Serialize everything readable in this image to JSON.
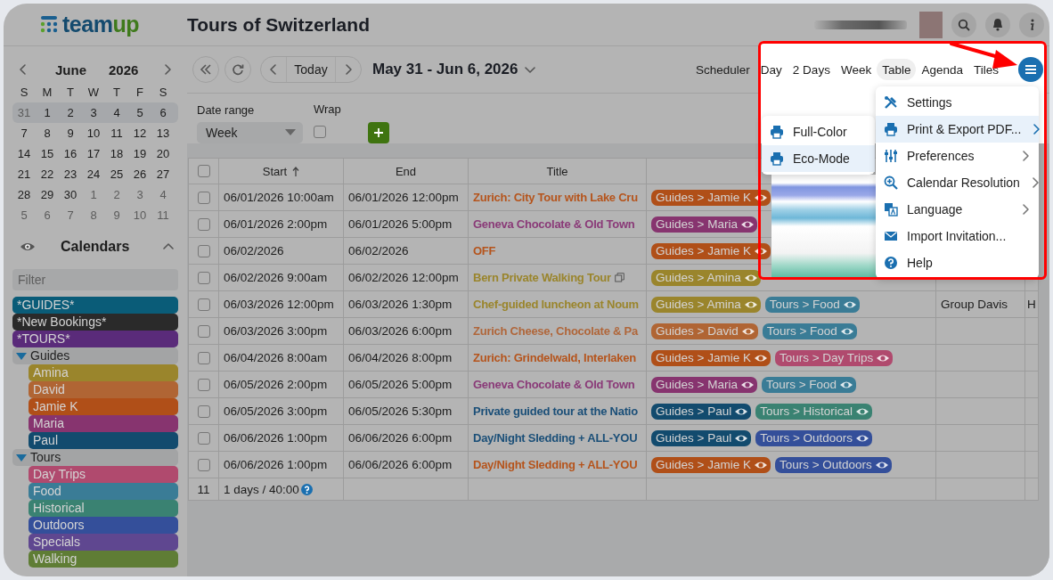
{
  "header": {
    "logo_parts": [
      "team",
      "up"
    ],
    "title": "Tours of Switzerland"
  },
  "mini_calendar": {
    "month": "June",
    "year": "2026",
    "weekdays": [
      "S",
      "M",
      "T",
      "W",
      "T",
      "F",
      "S"
    ],
    "weeks": [
      {
        "selected": true,
        "days": [
          {
            "d": "31",
            "muted": true
          },
          {
            "d": "1",
            "muted": false
          },
          {
            "d": "2",
            "muted": false
          },
          {
            "d": "3",
            "muted": false
          },
          {
            "d": "4",
            "muted": false
          },
          {
            "d": "5",
            "muted": false
          },
          {
            "d": "6",
            "muted": false
          }
        ]
      },
      {
        "selected": false,
        "days": [
          {
            "d": "7",
            "muted": false
          },
          {
            "d": "8",
            "muted": false
          },
          {
            "d": "9",
            "muted": false
          },
          {
            "d": "10",
            "muted": false
          },
          {
            "d": "11",
            "muted": false
          },
          {
            "d": "12",
            "muted": false
          },
          {
            "d": "13",
            "muted": false
          }
        ]
      },
      {
        "selected": false,
        "days": [
          {
            "d": "14",
            "muted": false
          },
          {
            "d": "15",
            "muted": false
          },
          {
            "d": "16",
            "muted": false
          },
          {
            "d": "17",
            "muted": false
          },
          {
            "d": "18",
            "muted": false
          },
          {
            "d": "19",
            "muted": false
          },
          {
            "d": "20",
            "muted": false
          }
        ]
      },
      {
        "selected": false,
        "days": [
          {
            "d": "21",
            "muted": false
          },
          {
            "d": "22",
            "muted": false
          },
          {
            "d": "23",
            "muted": false
          },
          {
            "d": "24",
            "muted": false
          },
          {
            "d": "25",
            "muted": false
          },
          {
            "d": "26",
            "muted": false
          },
          {
            "d": "27",
            "muted": false
          }
        ]
      },
      {
        "selected": false,
        "days": [
          {
            "d": "28",
            "muted": false
          },
          {
            "d": "29",
            "muted": false
          },
          {
            "d": "30",
            "muted": false
          },
          {
            "d": "1",
            "muted": true
          },
          {
            "d": "2",
            "muted": true
          },
          {
            "d": "3",
            "muted": true
          },
          {
            "d": "4",
            "muted": true
          }
        ]
      },
      {
        "selected": false,
        "days": [
          {
            "d": "5",
            "muted": true
          },
          {
            "d": "6",
            "muted": true
          },
          {
            "d": "7",
            "muted": true
          },
          {
            "d": "8",
            "muted": true
          },
          {
            "d": "9",
            "muted": true
          },
          {
            "d": "10",
            "muted": true
          },
          {
            "d": "11",
            "muted": true
          }
        ]
      }
    ]
  },
  "calendars": {
    "title": "Calendars",
    "expanded": true,
    "filter_placeholder": "Filter",
    "items": [
      {
        "kind": "calendar",
        "label": "*GUIDES*",
        "color": "#0a5c78"
      },
      {
        "kind": "calendar",
        "label": "*New Bookings*",
        "color": "#2a2a2a"
      },
      {
        "kind": "calendar",
        "label": "*TOURS*",
        "color": "#5a2b7a"
      },
      {
        "kind": "folder",
        "label": "Guides",
        "expanded": true,
        "children": [
          {
            "kind": "calendar",
            "label": "Amina",
            "color": "#9a852c"
          },
          {
            "kind": "calendar",
            "label": "David",
            "color": "#b06534"
          },
          {
            "kind": "calendar",
            "label": "Jamie K",
            "color": "#b04f18"
          },
          {
            "kind": "calendar",
            "label": "Maria",
            "color": "#87346f"
          },
          {
            "kind": "calendar",
            "label": "Paul",
            "color": "#124b6e"
          }
        ]
      },
      {
        "kind": "folder",
        "label": "Tours",
        "expanded": true,
        "children": [
          {
            "kind": "calendar",
            "label": "Day Trips",
            "color": "#b04a6e"
          },
          {
            "kind": "calendar",
            "label": "Food",
            "color": "#3a7c96"
          },
          {
            "kind": "calendar",
            "label": "Historical",
            "color": "#3a8272"
          },
          {
            "kind": "calendar",
            "label": "Outdoors",
            "color": "#344f9a"
          },
          {
            "kind": "calendar",
            "label": "Specials",
            "color": "#5f4790"
          },
          {
            "kind": "calendar",
            "label": "Walking",
            "color": "#5f7d35"
          }
        ]
      }
    ]
  },
  "toolbar": {
    "today": "Today",
    "range": "May 31 - Jun 6, 2026",
    "views": [
      {
        "label": "Scheduler",
        "selected": false
      },
      {
        "label": "Day",
        "selected": false
      },
      {
        "label": "2 Days",
        "selected": false
      },
      {
        "label": "Week",
        "selected": false
      },
      {
        "label": "Table",
        "selected": true
      },
      {
        "label": "Agenda",
        "selected": false
      },
      {
        "label": "Tiles",
        "selected": false
      }
    ]
  },
  "filters": {
    "date_range_label": "Date range",
    "date_range_value": "Week",
    "wrap_label": "Wrap",
    "wrap_checked": false
  },
  "table": {
    "all_checked": false,
    "columns": [
      {
        "label": "Start",
        "sorted": true
      },
      {
        "label": "End",
        "sorted": false
      },
      {
        "label": "Title",
        "sorted": false
      }
    ],
    "rows": [
      {
        "checked": false,
        "start": "06/01/2026 10:00am",
        "end": "06/01/2026 12:00pm",
        "title": "Zurich: City Tour with Lake Cru",
        "color": "#b5541c",
        "copy_icon": false,
        "tags": [
          {
            "label": "Guides > Jamie K",
            "color": "#b04f18"
          }
        ]
      },
      {
        "checked": false,
        "start": "06/01/2026 2:00pm",
        "end": "06/01/2026 5:00pm",
        "title": "Geneva Chocolate & Old Town",
        "color": "#8a3a78",
        "copy_icon": false,
        "tags": [
          {
            "label": "Guides > Maria",
            "color": "#87346f"
          }
        ]
      },
      {
        "checked": false,
        "start": "06/02/2026",
        "end": "06/02/2026",
        "title": "OFF",
        "color": "#b5541c",
        "copy_icon": false,
        "tags": [
          {
            "label": "Guides > Jamie K",
            "color": "#b04f18"
          }
        ]
      },
      {
        "checked": false,
        "start": "06/02/2026 9:00am",
        "end": "06/02/2026 12:00pm",
        "title": "Bern Private Walking Tour",
        "color": "#9a852c",
        "copy_icon": true,
        "tags": [
          {
            "label": "Guides > Amina",
            "color": "#9a852c"
          }
        ]
      },
      {
        "checked": false,
        "start": "06/03/2026 12:00pm",
        "end": "06/03/2026 1:30pm",
        "title": "Chef-guided luncheon at Noum",
        "color": "#9a852c",
        "copy_icon": false,
        "tags": [
          {
            "label": "Guides > Amina",
            "color": "#9a852c"
          },
          {
            "label": "Tours > Food",
            "color": "#3a7c96"
          }
        ],
        "column_6": "Group Davis",
        "column_7": "H"
      },
      {
        "checked": false,
        "start": "06/03/2026 3:00pm",
        "end": "06/03/2026 6:00pm",
        "title": "Zurich Cheese, Chocolate & Pa",
        "color": "#b0663a",
        "copy_icon": false,
        "tags": [
          {
            "label": "Guides > David",
            "color": "#b06534"
          },
          {
            "label": "Tours > Food",
            "color": "#3a7c96"
          }
        ]
      },
      {
        "checked": false,
        "start": "06/04/2026 8:00am",
        "end": "06/04/2026 8:00pm",
        "title": "Zurich: Grindelwald, Interlaken",
        "color": "#b5541c",
        "copy_icon": false,
        "tags": [
          {
            "label": "Guides > Jamie K",
            "color": "#b04f18"
          },
          {
            "label": "Tours > Day Trips",
            "color": "#b04a6e"
          }
        ]
      },
      {
        "checked": false,
        "start": "06/05/2026 2:00pm",
        "end": "06/05/2026 5:00pm",
        "title": "Geneva Chocolate & Old Town",
        "color": "#8a3a78",
        "copy_icon": false,
        "tags": [
          {
            "label": "Guides > Maria",
            "color": "#87346f"
          },
          {
            "label": "Tours > Food",
            "color": "#3a7c96"
          }
        ]
      },
      {
        "checked": false,
        "start": "06/05/2026 3:00pm",
        "end": "06/05/2026 5:30pm",
        "title": "Private guided tour at the Natio",
        "color": "#1b4f78",
        "copy_icon": false,
        "tags": [
          {
            "label": "Guides > Paul",
            "color": "#124b6e"
          },
          {
            "label": "Tours > Historical",
            "color": "#3a8272"
          }
        ]
      },
      {
        "checked": false,
        "start": "06/06/2026 1:00pm",
        "end": "06/06/2026 6:00pm",
        "title": "Day/Night Sledding + ALL-YOU",
        "color": "#1b4f78",
        "copy_icon": false,
        "tags": [
          {
            "label": "Guides > Paul",
            "color": "#124b6e"
          },
          {
            "label": "Tours > Outdoors",
            "color": "#344f9a"
          }
        ]
      },
      {
        "checked": false,
        "start": "06/06/2026 1:00pm",
        "end": "06/06/2026 6:00pm",
        "title": "Day/Night Sledding + ALL-YOU",
        "color": "#b5541c",
        "copy_icon": false,
        "tags": [
          {
            "label": "Guides > Jamie K",
            "color": "#b04f18"
          },
          {
            "label": "Tours > Outdoors",
            "color": "#344f9a"
          }
        ]
      }
    ],
    "footer": {
      "count": "11",
      "summary": "1 days / 40:00"
    }
  },
  "print_submenu": {
    "items": [
      {
        "label": "Full-Color",
        "selected": false
      },
      {
        "label": "Eco-Mode",
        "selected": true
      }
    ]
  },
  "menu": {
    "items": [
      {
        "label": "Settings",
        "selected": false,
        "has_submenu": false
      },
      {
        "label": "Print & Export PDF...",
        "selected": true,
        "has_submenu": true
      },
      {
        "label": "Preferences",
        "selected": false,
        "has_submenu": true
      },
      {
        "label": "Calendar Resolution",
        "selected": false,
        "has_submenu": true
      },
      {
        "label": "Language",
        "selected": false,
        "has_submenu": true
      },
      {
        "label": "Import Invitation...",
        "selected": false,
        "has_submenu": false
      },
      {
        "label": "Help",
        "selected": false,
        "has_submenu": false
      }
    ]
  }
}
